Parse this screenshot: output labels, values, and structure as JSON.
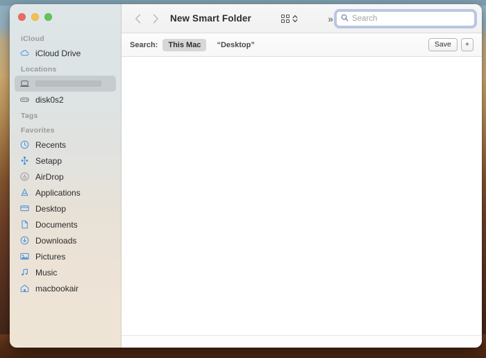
{
  "window": {
    "title": "New Smart Folder",
    "traffic_lights": [
      {
        "name": "close",
        "color": "#ec6a5f"
      },
      {
        "name": "minimize",
        "color": "#f4bf50"
      },
      {
        "name": "zoom",
        "color": "#61c455"
      }
    ]
  },
  "toolbar": {
    "back_label": "‹",
    "forward_label": "›",
    "overflow_label": "»",
    "view_icon": "grid-view-icon",
    "view_stepper_icon": "chevron-up-down-icon"
  },
  "search": {
    "placeholder": "Search",
    "value": "",
    "icon": "search-icon"
  },
  "scopebar": {
    "label": "Search:",
    "scopes": [
      {
        "label": "This Mac",
        "active": true
      },
      {
        "label": "“Desktop”",
        "active": false
      }
    ],
    "save_label": "Save",
    "add_label": "+"
  },
  "sidebar": {
    "sections": [
      {
        "title": "iCloud",
        "items": [
          {
            "label": "iCloud Drive",
            "icon": "cloud-icon",
            "selected": false,
            "redacted": false
          }
        ]
      },
      {
        "title": "Locations",
        "items": [
          {
            "label": "",
            "icon": "laptop-icon",
            "selected": true,
            "redacted": true
          },
          {
            "label": "disk0s2",
            "icon": "disk-icon",
            "selected": false,
            "redacted": false
          }
        ]
      },
      {
        "title": "Tags",
        "items": []
      },
      {
        "title": "Favorites",
        "items": [
          {
            "label": "Recents",
            "icon": "clock-icon",
            "selected": false,
            "redacted": false
          },
          {
            "label": "Setapp",
            "icon": "setapp-icon",
            "selected": false,
            "redacted": false
          },
          {
            "label": "AirDrop",
            "icon": "airdrop-icon",
            "selected": false,
            "redacted": false
          },
          {
            "label": "Applications",
            "icon": "applications-icon",
            "selected": false,
            "redacted": false
          },
          {
            "label": "Desktop",
            "icon": "desktop-icon",
            "selected": false,
            "redacted": false
          },
          {
            "label": "Documents",
            "icon": "document-icon",
            "selected": false,
            "redacted": false
          },
          {
            "label": "Downloads",
            "icon": "downloads-icon",
            "selected": false,
            "redacted": false
          },
          {
            "label": "Pictures",
            "icon": "pictures-icon",
            "selected": false,
            "redacted": false
          },
          {
            "label": "Music",
            "icon": "music-icon",
            "selected": false,
            "redacted": false
          },
          {
            "label": "macbookair",
            "icon": "home-icon",
            "selected": false,
            "redacted": false
          }
        ]
      }
    ]
  },
  "filelist": {
    "items": []
  },
  "colors": {
    "accent_blue": "#3a7fd5",
    "sidebar_icon_blue": "#4a90d9",
    "selection_gray": "#d7d7d7",
    "focus_ring": "#748fd2"
  }
}
